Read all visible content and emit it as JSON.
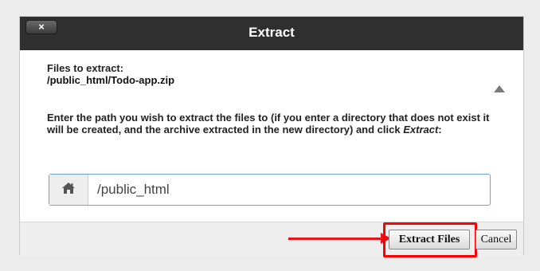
{
  "dialog": {
    "title": "Extract",
    "close_label": "×",
    "files_label": "Files to extract:",
    "files_path": "/public_html/Todo-app.zip",
    "instructions": "Enter the path you wish to extract the files to (if you enter a directory that does not exist it will be created, and the archive extracted in the new directory) and click",
    "instructions_action": "Extract",
    "instructions_end": ":",
    "path_value": "/public_html",
    "home_icon": "home-icon",
    "extract_button": "Extract Files",
    "cancel_button": "Cancel"
  },
  "colors": {
    "titlebar": "#2f2f2f",
    "annotation": "#e8141b",
    "input_focus_border": "#6fa3d6"
  }
}
